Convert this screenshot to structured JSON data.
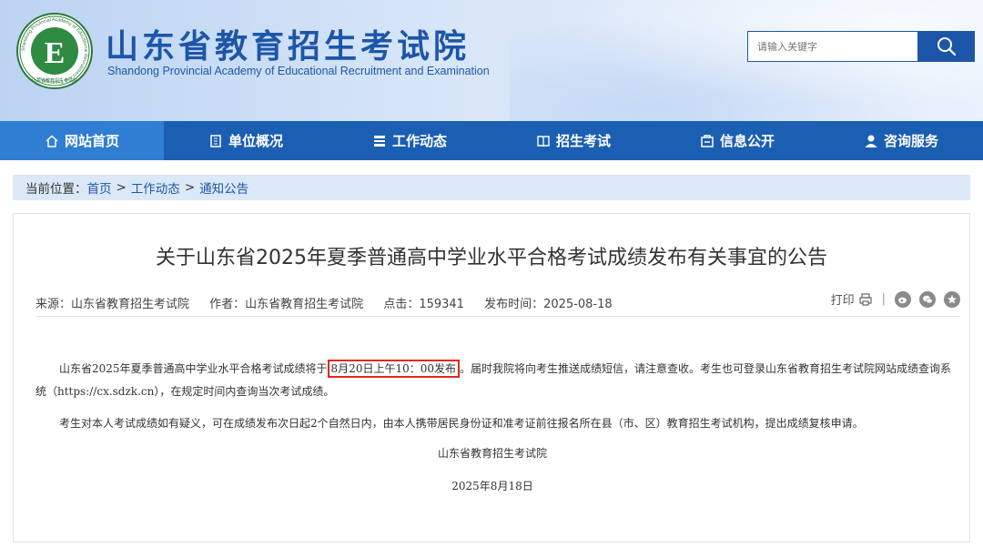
{
  "header": {
    "title": "山东省教育招生考试院",
    "subtitle": "Shandong Provincial Academy of Educational Recruitment and Examination",
    "logo_ring_text": "Shandong Provincial Academy of Educational Recruitment and Examination",
    "logo_bottom_text": "山东省教育招生考试院",
    "search_placeholder": "请输入关键字"
  },
  "nav": {
    "items": [
      {
        "label": "网站首页",
        "icon": "home-icon"
      },
      {
        "label": "单位概况",
        "icon": "building-icon"
      },
      {
        "label": "工作动态",
        "icon": "list-icon"
      },
      {
        "label": "招生考试",
        "icon": "book-icon"
      },
      {
        "label": "信息公开",
        "icon": "info-icon"
      },
      {
        "label": "咨询服务",
        "icon": "user-icon"
      }
    ]
  },
  "breadcrumb": {
    "prefix": "当前位置：",
    "items": [
      "首页",
      "工作动态",
      "通知公告"
    ],
    "separator": ">"
  },
  "article": {
    "title": "关于山东省2025年夏季普通高中学业水平合格考试成绩发布有关事宜的公告",
    "source": "来源：山东省教育招生考试院",
    "author": "作者：山东省教育招生考试院",
    "clicks": "点击：159341",
    "published": "发布时间：2025-08-18",
    "print_label": "打印",
    "para1_pre": "山东省2025年夏季普通高中学业水平合格考试成绩将于",
    "para1_highlight": "8月20日上午10：00发布",
    "para1_post": "。届时我院将向考生推送成绩短信，请注意查收。考生也可登录山东省教育招生考试院网站成绩查询系统（https://cx.sdzk.cn），在规定时间内查询当次考试成绩。",
    "para2": "考生对本人考试成绩如有疑义，可在成绩发布次日起2个自然日内，由本人携带居民身份证和准考证前往报名所在县（市、区）教育招生考试机构，提出成绩复核申请。",
    "signature": "山东省教育招生考试院",
    "date": "2025年8月18日"
  },
  "colors": {
    "brand": "#1d56a8",
    "nav": "#1b5fb3",
    "nav_active": "#2f7ed3",
    "highlight_border": "#e5261f"
  }
}
